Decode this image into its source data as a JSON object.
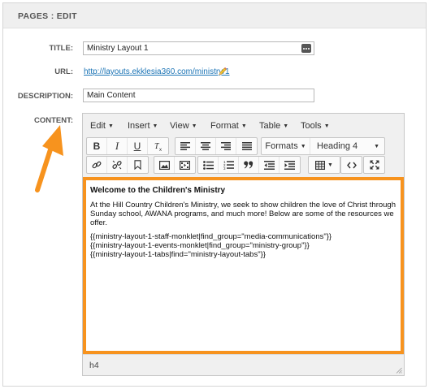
{
  "header": {
    "title": "PAGES : EDIT"
  },
  "form": {
    "title_label": "TITLE:",
    "title_value": "Ministry Layout 1",
    "url_label": "URL:",
    "url_value": "http://layouts.ekklesia360.com/ministry/1",
    "description_label": "DESCRIPTION:",
    "description_value": "Main Content",
    "content_label": "CONTENT:"
  },
  "editor": {
    "menu": [
      "Edit",
      "Insert",
      "View",
      "Format",
      "Table",
      "Tools"
    ],
    "toolbar": {
      "formats_label": "Formats",
      "block_format_value": "Heading 4"
    },
    "content": {
      "heading": "Welcome to the Children's Ministry",
      "paragraph": "At the Hill Country Children's Ministry, we seek to show children the love of Christ through Sunday school, AWANA programs, and much more! Below are some of the resources we offer.",
      "shortcodes": [
        "{{ministry-layout-1-staff-monklet|find_group=\"media-communications\"}}",
        "{{ministry-layout-1-events-monklet|find_group=\"ministry-group\"}}",
        "{{ministry-layout-1-tabs|find=\"ministry-layout-tabs\"}}"
      ]
    },
    "status_path": "h4"
  },
  "colors": {
    "highlight": "#f7931e",
    "link": "#1a73b5"
  }
}
